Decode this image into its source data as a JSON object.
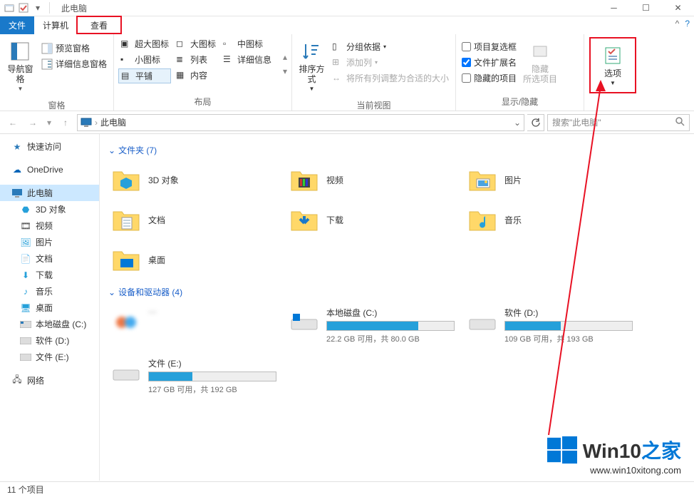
{
  "window": {
    "title": "此电脑"
  },
  "tabs": {
    "file": "文件",
    "computer": "计算机",
    "view": "查看"
  },
  "ribbon": {
    "panes": {
      "label": "窗格",
      "nav_pane": "导航窗格",
      "preview_pane": "预览窗格",
      "details_pane": "详细信息窗格"
    },
    "layout": {
      "label": "布局",
      "extra_large": "超大图标",
      "large": "大图标",
      "medium": "中图标",
      "small": "小图标",
      "list": "列表",
      "details": "详细信息",
      "tiles": "平铺",
      "content": "内容"
    },
    "current_view": {
      "label": "当前视图",
      "sort_by": "排序方式",
      "group_by": "分组依据",
      "add_columns": "添加列",
      "size_all": "将所有列调整为合适的大小"
    },
    "show_hide": {
      "label": "显示/隐藏",
      "item_checkboxes": "项目复选框",
      "file_ext": "文件扩展名",
      "hidden_items": "隐藏的项目",
      "hide_selected": "隐藏\n所选项目"
    },
    "options": {
      "label": "选项"
    }
  },
  "address": {
    "location": "此电脑"
  },
  "search": {
    "placeholder": "搜索\"此电脑\""
  },
  "sidebar": {
    "quick": "快速访问",
    "onedrive": "OneDrive",
    "thispc": "此电脑",
    "obj3d": "3D 对象",
    "videos": "视频",
    "pictures": "图片",
    "documents": "文档",
    "downloads": "下载",
    "music": "音乐",
    "desktop": "桌面",
    "driveC": "本地磁盘 (C:)",
    "driveD": "软件 (D:)",
    "driveE": "文件 (E:)",
    "network": "网络"
  },
  "sections": {
    "folders": "文件夹 (7)",
    "drives": "设备和驱动器 (4)"
  },
  "folders": {
    "obj3d": "3D 对象",
    "videos": "视频",
    "pictures": "图片",
    "documents": "文档",
    "downloads": "下载",
    "music": "音乐",
    "desktop": "桌面"
  },
  "drives": {
    "c": {
      "name": "本地磁盘 (C:)",
      "sub": "22.2 GB 可用，共 80.0 GB",
      "pct": 72
    },
    "d": {
      "name": "软件 (D:)",
      "sub": "109 GB 可用，共 193 GB",
      "pct": 44
    },
    "e": {
      "name": "文件 (E:)",
      "sub": "127 GB 可用，共 192 GB",
      "pct": 34
    }
  },
  "status": {
    "items": "11 个项目"
  },
  "watermark": {
    "brand_a": "Win10",
    "brand_b": "之家",
    "url": "www.win10xitong.com"
  }
}
